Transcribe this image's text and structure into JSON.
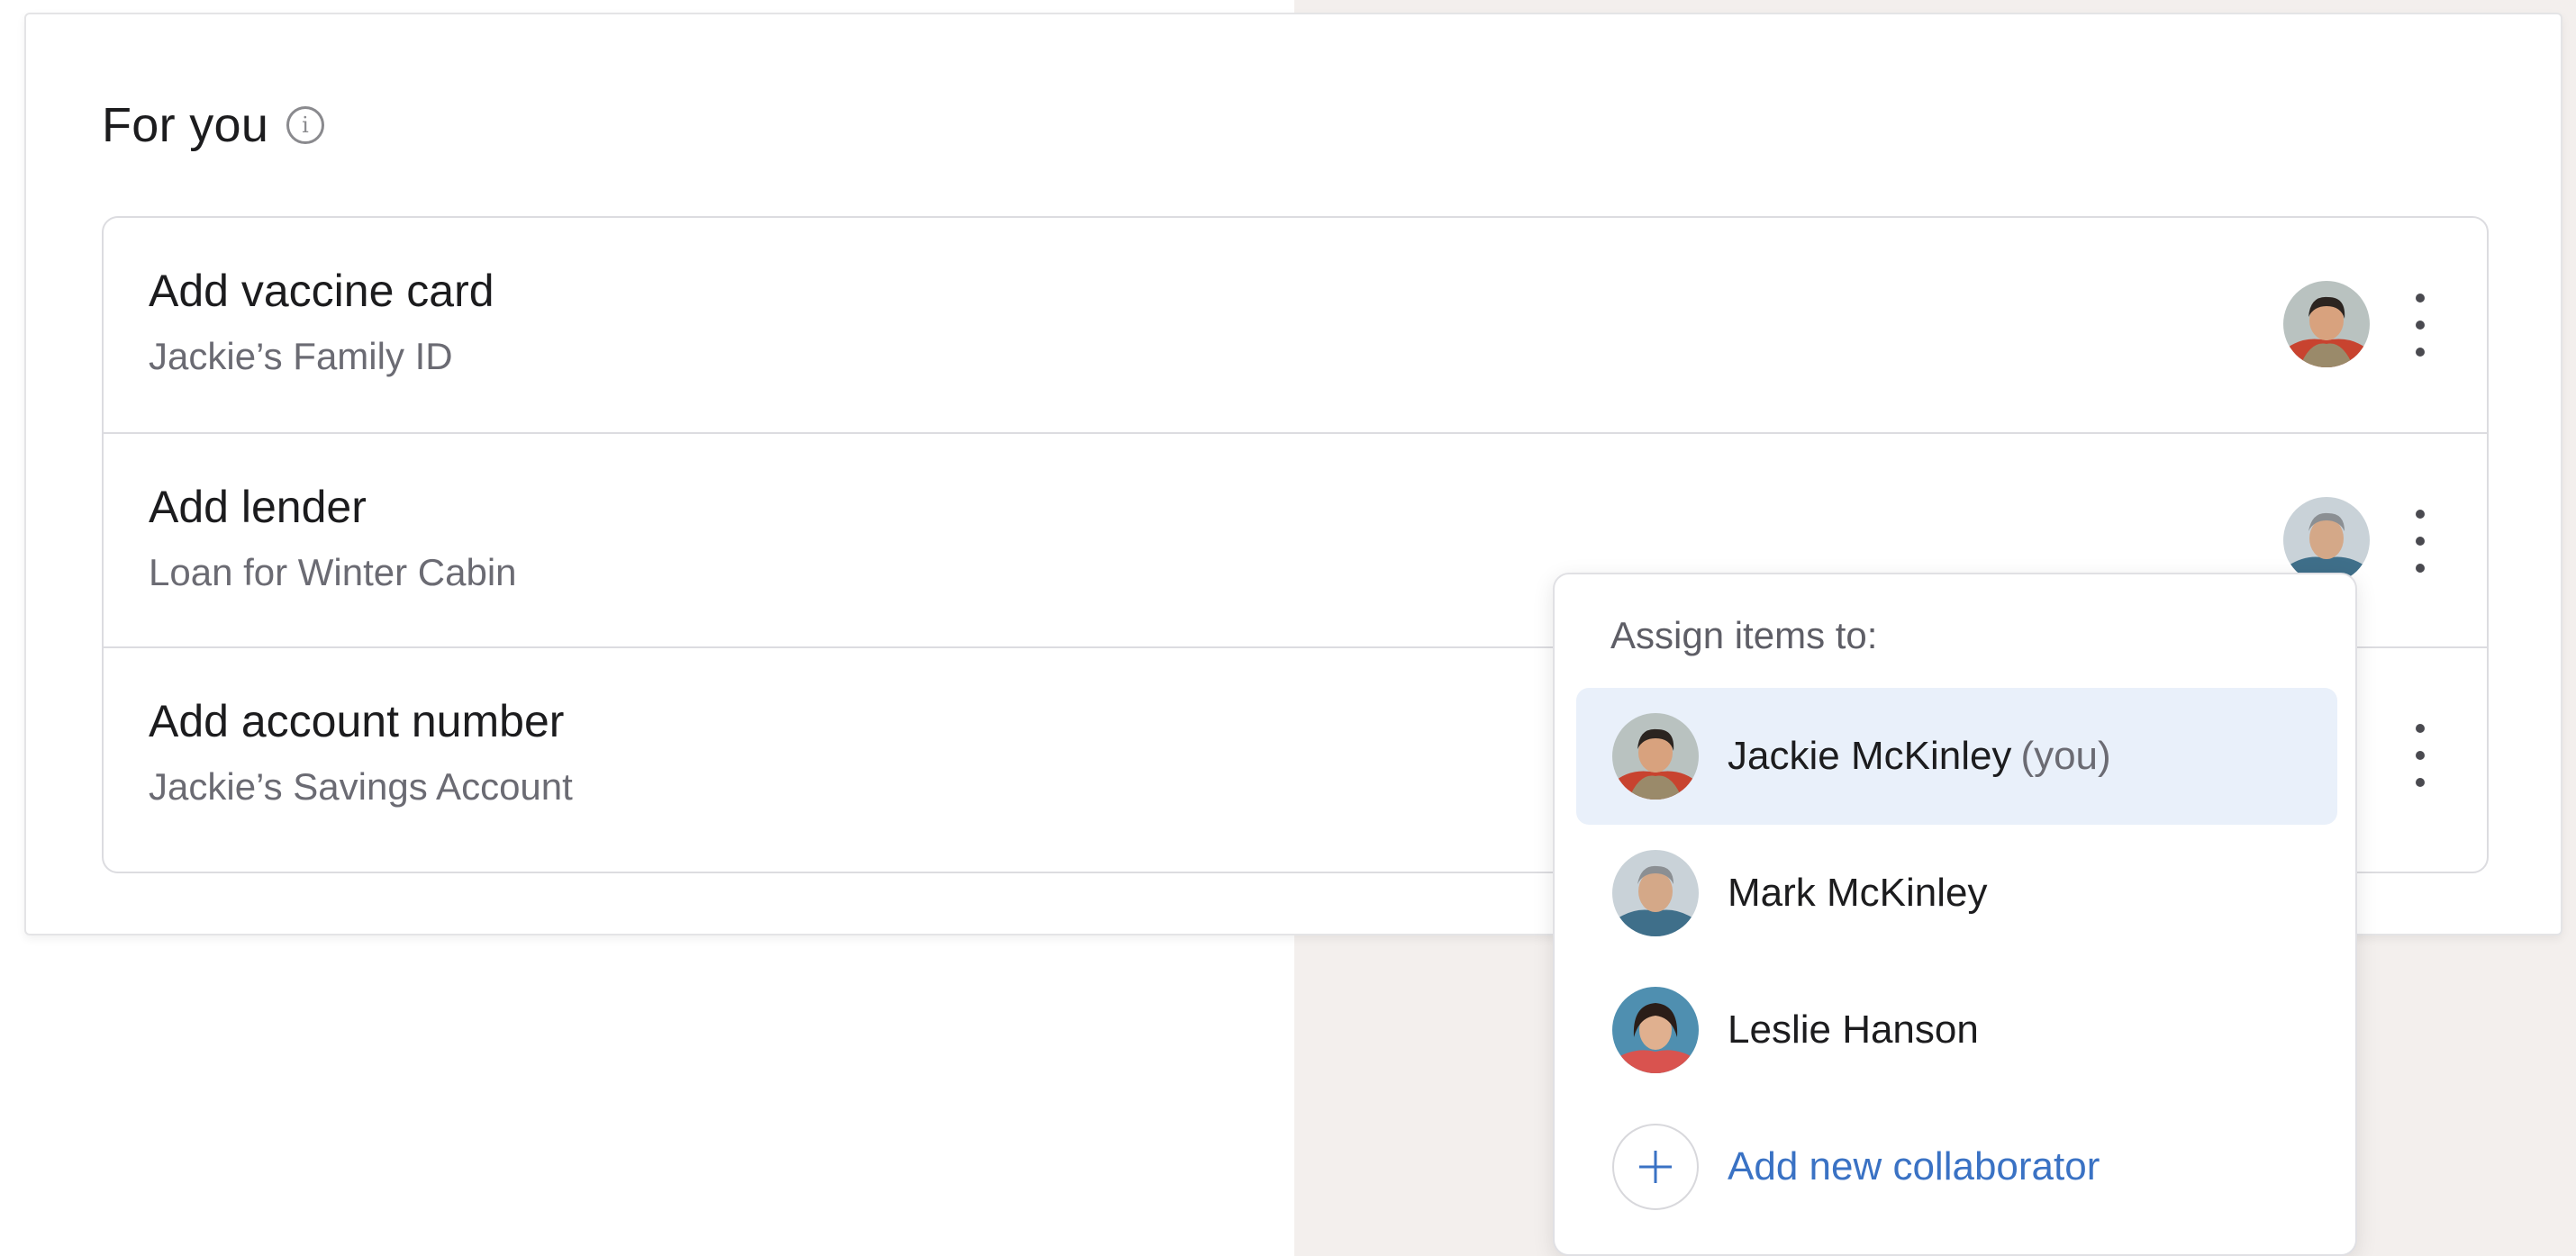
{
  "section": {
    "title": "For you",
    "info_icon": "info-icon"
  },
  "tasks": [
    {
      "title": "Add vaccine card",
      "subtitle": "Jackie’s Family ID",
      "assignee": "Jackie McKinley"
    },
    {
      "title": "Add lender",
      "subtitle": "Loan for Winter Cabin",
      "assignee": "Mark McKinley"
    },
    {
      "title": "Add account number",
      "subtitle": "Jackie’s Savings Account",
      "assignee": ""
    }
  ],
  "assign_menu": {
    "heading": "Assign items to:",
    "options": [
      {
        "name": "Jackie McKinley",
        "suffix": "(you)",
        "selected": true
      },
      {
        "name": "Mark McKinley",
        "suffix": "",
        "selected": false
      },
      {
        "name": "Leslie Hanson",
        "suffix": "",
        "selected": false
      }
    ],
    "add_label": "Add new collaborator"
  },
  "colors": {
    "accent": "#3a72c4",
    "selected_bg": "#e9f0fa",
    "page_bg_right": "#f3efed"
  }
}
